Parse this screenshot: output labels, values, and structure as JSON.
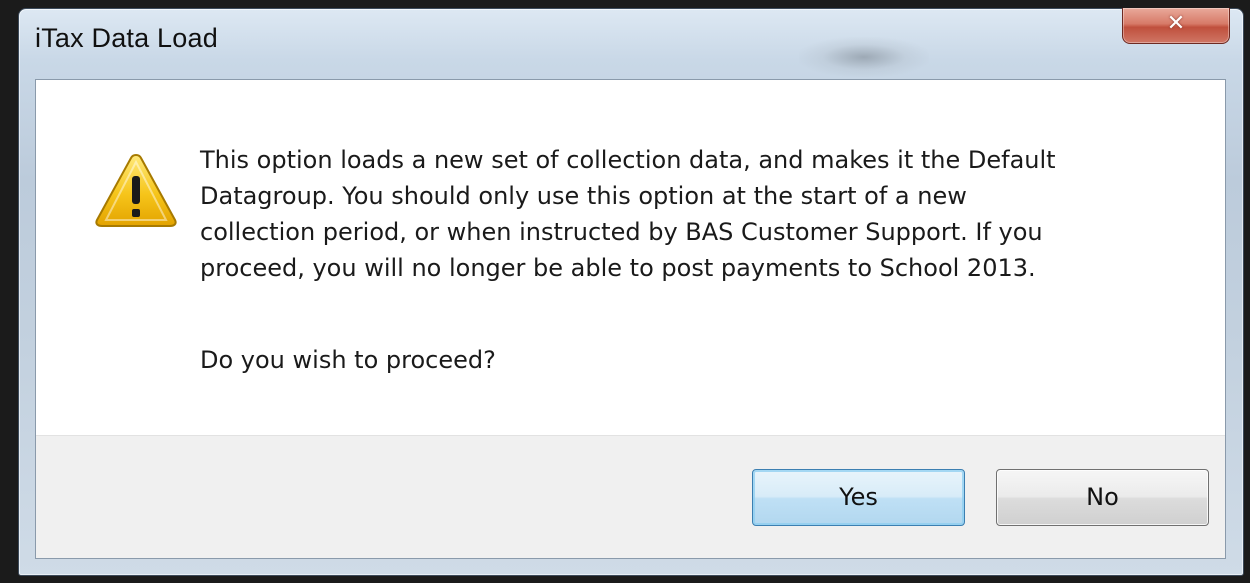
{
  "window": {
    "title": "iTax Data Load",
    "close_icon": "close-x-icon"
  },
  "dialog": {
    "icon": "warning-icon",
    "message": "This option loads a new set of collection data, and makes it the Default\nDatagroup. You should only use this option at the start of a new\ncollection period, or when instructed by BAS Customer Support.  If you\nproceed, you will no longer be able to post payments to School 2013.",
    "question": "Do you wish to proceed?"
  },
  "buttons": {
    "yes_label": "Yes",
    "no_label": "No",
    "default": "Yes"
  },
  "colors": {
    "focus_accent": "#3c7fb1",
    "close_button": "#c0503d",
    "warning_fill": "#f6c51a"
  }
}
